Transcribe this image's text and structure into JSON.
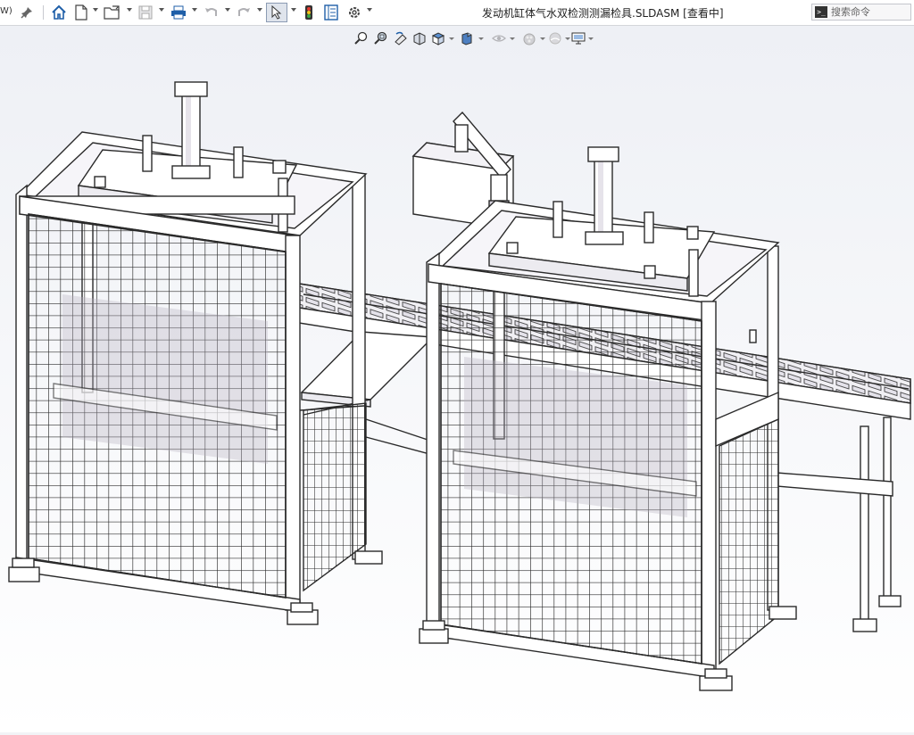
{
  "app": {
    "title": "发动机缸体气水双检测测漏检具.SLDASM [查看中]",
    "menu_stub": "W)"
  },
  "search": {
    "placeholder": "搜索命令"
  },
  "toolbar": {
    "icons": [
      "pin-icon",
      "home-icon",
      "new-document-icon",
      "open-folder-icon",
      "save-icon",
      "print-icon",
      "undo-icon",
      "redo-icon",
      "select-cursor-icon",
      "traffic-light-icon",
      "file-properties-icon",
      "options-gear-icon"
    ]
  },
  "heads_up": {
    "icons": [
      "zoom-to-fit-icon",
      "zoom-to-area-icon",
      "previous-view-icon",
      "section-view-icon",
      "view-orientation-icon",
      "display-style-icon",
      "hide-show-icon",
      "edit-appearance-icon",
      "apply-scene-icon",
      "view-settings-icon"
    ]
  },
  "colors": {
    "viewport_top": "#f4f5f8",
    "viewport_bottom": "#ffffff",
    "frame_fill": "#ffffff",
    "line": "#2a2a2a",
    "accent_shadow": "#b7b2bf"
  }
}
